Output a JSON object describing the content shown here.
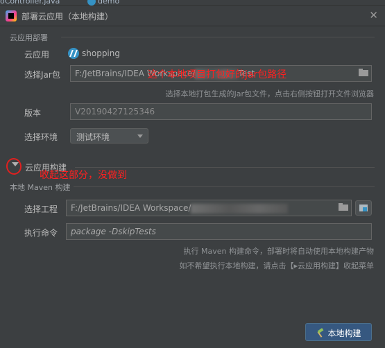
{
  "background_tabs": [
    "oController.java",
    "demo"
  ],
  "dialog": {
    "title": "部署云应用（本地构建）",
    "close_icon": "close-icon"
  },
  "cloud_deploy": {
    "section_title": "云应用部署",
    "app_label": "云应用",
    "app_name": "shopping",
    "jar_label": "选择Jar包",
    "jar_path": "F:/JetBrains/IDEA Workspace/",
    "jar_path_tail": "Test",
    "jar_hint": "选择本地打包生成的Jar包文件，点击右侧按钮打开文件浏览器",
    "version_label": "版本",
    "version_value": "V20190427125346",
    "env_label": "选择环境",
    "env_selected": "测试环境"
  },
  "cloud_build": {
    "section_title": "云应用构建"
  },
  "local_build": {
    "section_title": "本地 Maven 构建",
    "project_label": "选择工程",
    "project_path": "F:/JetBrains/IDEA Workspace/",
    "command_label": "执行命令",
    "command_value": "package -DskipTests",
    "hint_1": "执行 Maven 构建命令，部署时将自动使用本地构建产物",
    "hint_2": "如不希望执行本地构建，请点击【▸云应用构建】收起菜单"
  },
  "actions": {
    "local_build_button": "本地构建"
  },
  "annotations": {
    "jar_note": "这个本地项目打包好的jar包路径",
    "collapse_note": "收起这部分，没做到"
  },
  "colors": {
    "dialog_bg": "#3c3f41",
    "field_bg": "#45494a",
    "primary_button": "#365880",
    "annotation": "#ff2020"
  }
}
